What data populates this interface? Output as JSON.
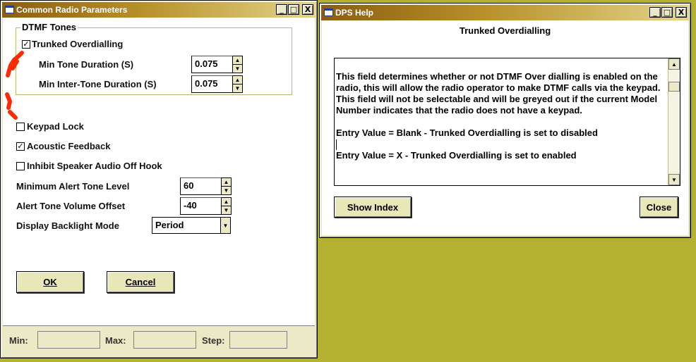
{
  "colors": {
    "desktop": "#b3b032",
    "title_start": "#8b5e10",
    "title_end": "#e4d48a",
    "panel": "#ece9c6",
    "annotation": "#ff2a00"
  },
  "title_buttons": {
    "minimize": "_",
    "maximize": "□",
    "close": "X"
  },
  "params_window": {
    "title": "Common Radio Parameters",
    "dtmf_group": {
      "title": "DTMF Tones",
      "trunked_overdialling": {
        "label": "Trunked Overdialling",
        "checked": true
      },
      "min_tone_duration": {
        "label": "Min Tone Duration (S)",
        "value": "0.075"
      },
      "min_inter_tone_duration": {
        "label": "Min Inter-Tone Duration (S)",
        "value": "0.075"
      }
    },
    "keypad_lock": {
      "label": "Keypad Lock",
      "checked": false
    },
    "acoustic_feedback": {
      "label": "Acoustic Feedback",
      "checked": true
    },
    "inhibit_speaker": {
      "label": "Inhibit Speaker Audio Off Hook",
      "checked": false
    },
    "min_alert_tone": {
      "label": "Minimum Alert Tone Level",
      "value": "60"
    },
    "alert_tone_offset": {
      "label": "Alert Tone Volume Offset",
      "value": "-40"
    },
    "backlight_mode": {
      "label": "Display Backlight Mode",
      "value": "Period"
    },
    "ok_label": "OK",
    "cancel_label": "Cancel",
    "status": {
      "min_label": "Min:",
      "max_label": "Max:",
      "step_label": "Step:",
      "min_value": "",
      "max_value": "",
      "step_value": ""
    }
  },
  "help_window": {
    "title": "DPS Help",
    "topic": "Trunked Overdialling",
    "paragraphs": [
      "This field determines whether or not DTMF Over dialling is enabled on the radio, this will allow the radio operator to make DTMF calls via the keypad. This field will not be selectable and will be greyed out if the current Model Number indicates that the radio does not have a keypad.",
      "Entry Value = Blank - Trunked Overdialling is set to disabled",
      "Entry Value = X - Trunked Overdialling is set to enabled"
    ],
    "show_index_label": "Show Index",
    "close_label": "Close"
  }
}
